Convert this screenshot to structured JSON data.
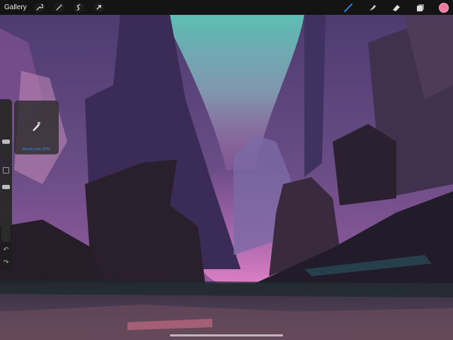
{
  "topbar": {
    "gallery_label": "Gallery",
    "left_tools": [
      "wrench-icon",
      "magic-wand-icon",
      "selection-icon",
      "transform-arrow-icon"
    ],
    "right_tools": [
      "brush-icon",
      "smudge-icon",
      "eraser-icon",
      "layers-icon"
    ],
    "active_tool": "brush-icon",
    "accent_color": "#2f8ff0",
    "current_color": "#f07aa0"
  },
  "sidebar": {
    "brush_size_level": 0.25,
    "opacity_level": 0.9
  },
  "brush_popup": {
    "label": "Brush size 25%"
  },
  "artwork": {
    "subject": "digital painting"
  }
}
